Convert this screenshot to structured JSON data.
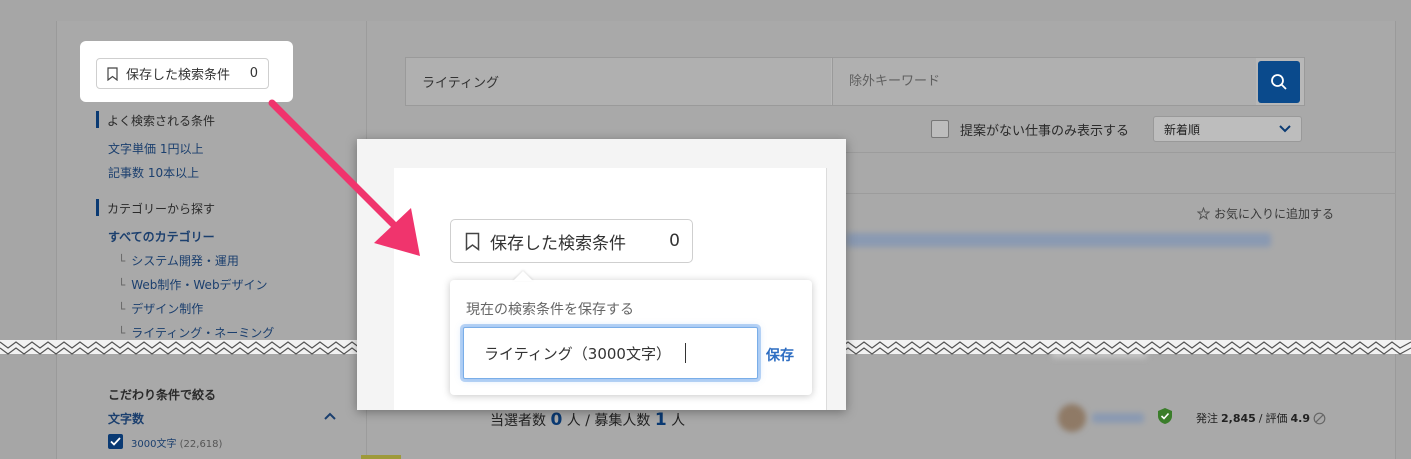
{
  "sidebar": {
    "saved_search_label": "保存した検索条件",
    "saved_search_count": "0",
    "popular_heading": "よく検索される条件",
    "popular_items": [
      "文字単価 1円以上",
      "記事数 10本以上"
    ],
    "category_heading": "カテゴリーから探す",
    "category_all": "すべてのカテゴリー",
    "category_items": [
      "システム開発・運用",
      "Web制作・Webデザイン",
      "デザイン制作",
      "ライティング・ネーミング"
    ],
    "filter_heading": "こだわり条件で絞る",
    "filter_group": "文字数",
    "filter_option_label": "3000文字",
    "filter_option_count": "(22,618)"
  },
  "search": {
    "keyword_value": "ライティング",
    "exclude_placeholder": "除外キーワード",
    "only_no_proposals_label": "提案がない仕事のみ表示する",
    "sort_value": "新着順"
  },
  "job": {
    "favorite_label": "お気に入りに追加する",
    "winners_label": "当選者数",
    "winners_count": "0",
    "winners_unit": "人",
    "separator": "/",
    "recruit_label": "募集人数",
    "recruit_count": "1",
    "recruit_unit": "人",
    "orders_label": "発注",
    "orders_count": "2,845",
    "rating_label": "評価",
    "rating_value": "4.9"
  },
  "zoom": {
    "pill_label": "保存した検索条件",
    "pill_count": "0",
    "popover_title": "現在の検索条件を保存する",
    "input_value": "ライティング（3000文字）",
    "save_label": "保存"
  },
  "colors": {
    "accent": "#0a4a8c",
    "arrow": "#f0346d",
    "save_link": "#2d6dc2",
    "focus": "#7aaee8"
  },
  "icons": [
    "bookmark-icon",
    "search-icon",
    "chevron-down-icon",
    "star-icon",
    "shield-check-icon",
    "prohibited-icon",
    "check-icon"
  ]
}
